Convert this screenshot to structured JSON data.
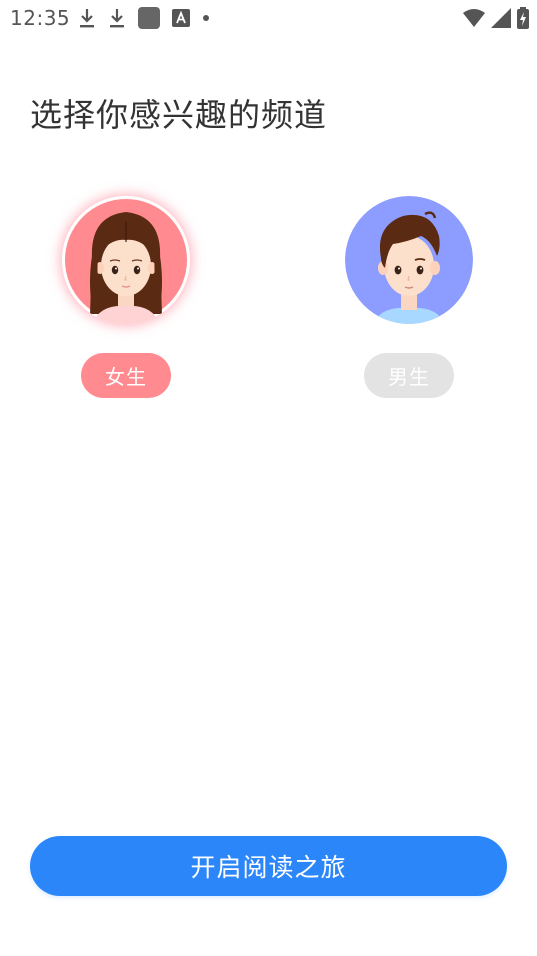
{
  "status_bar": {
    "time": "12:35",
    "left_icons": [
      "download-icon",
      "download-icon",
      "app-square-icon",
      "text-a-icon",
      "dot-icon"
    ],
    "right_icons": [
      "wifi-icon",
      "cell-signal-icon",
      "battery-charging-icon"
    ]
  },
  "header": {
    "title": "选择你感兴趣的频道"
  },
  "channels": [
    {
      "label": "女生",
      "avatar": "female-avatar-icon",
      "selected": true,
      "pill_color": "#ff8a8f",
      "avatar_bg": "#ff8a8f"
    },
    {
      "label": "男生",
      "avatar": "male-avatar-icon",
      "selected": false,
      "pill_color": "#e3e3e3",
      "avatar_bg": "#8c9cff"
    }
  ],
  "footer": {
    "start_label": "开启阅读之旅",
    "button_color": "#2b86fa"
  }
}
